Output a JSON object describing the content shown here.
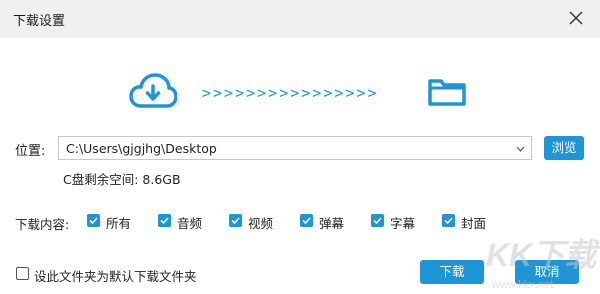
{
  "window": {
    "title": "下载设置"
  },
  "transfer": {
    "arrows": ">>>>>>>>>>>>>>>>"
  },
  "location": {
    "label": "位置:",
    "path": "C:\\Users\\gjgjhg\\Desktop",
    "browse_label": "浏览",
    "free_space": "C盘剩余空间: 8.6GB"
  },
  "content": {
    "label": "下载内容:",
    "options": [
      {
        "label": "所有",
        "checked": true
      },
      {
        "label": "音频",
        "checked": true
      },
      {
        "label": "视频",
        "checked": true
      },
      {
        "label": "弹幕",
        "checked": true
      },
      {
        "label": "字幕",
        "checked": true
      },
      {
        "label": "封面",
        "checked": true
      }
    ]
  },
  "footer": {
    "default_folder_label": "设此文件夹为默认下载文件夹",
    "default_folder_checked": false,
    "download_label": "下载",
    "cancel_label": "取消"
  },
  "watermark": {
    "text": "KK下载",
    "url_text": "www.kkx.net"
  },
  "colors": {
    "accent": "#1e95d6",
    "titlebar": "#f0f0f0"
  }
}
